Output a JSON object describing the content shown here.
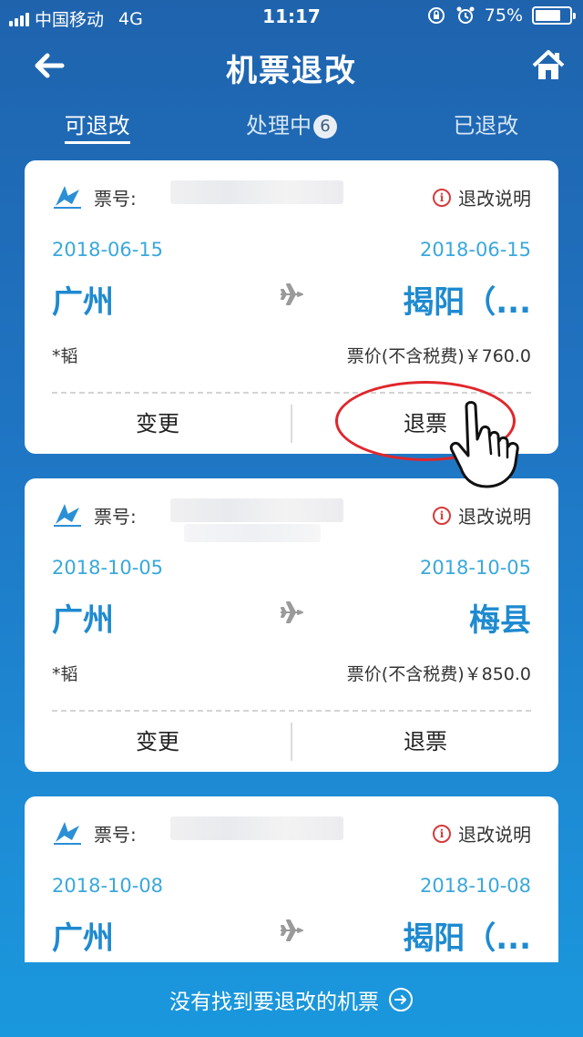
{
  "status_bar": {
    "carrier": "中国移动",
    "network": "4G",
    "time": "11:17",
    "battery": "75%",
    "battery_level": 0.75,
    "icons": [
      "signal-icon",
      "orientation-lock-icon",
      "alarm-icon",
      "battery-icon"
    ]
  },
  "header": {
    "title": "机票退改",
    "back_icon": "arrow-left-icon",
    "home_icon": "home-icon"
  },
  "tabs": [
    {
      "label": "可退改",
      "active": true
    },
    {
      "label": "处理中",
      "badge": "6",
      "active": false
    },
    {
      "label": "已退改",
      "active": false
    }
  ],
  "cards": [
    {
      "ticket_label": "票号:",
      "explain_label": "退改说明",
      "date_from": "2018-06-15",
      "date_to": "2018-06-15",
      "city_from": "广州",
      "city_to": "揭阳（...",
      "passenger": "*韬",
      "price": "票价(不含税费)￥760.0",
      "change_label": "变更",
      "refund_label": "退票"
    },
    {
      "ticket_label": "票号:",
      "explain_label": "退改说明",
      "date_from": "2018-10-05",
      "date_to": "2018-10-05",
      "city_from": "广州",
      "city_to": "梅县",
      "passenger": "*韬",
      "price": "票价(不含税费)￥850.0",
      "change_label": "变更",
      "refund_label": "退票"
    },
    {
      "ticket_label": "票号:",
      "explain_label": "退改说明",
      "date_from": "2018-10-08",
      "date_to": "2018-10-08",
      "city_from": "广州",
      "city_to": "揭阳（..."
    }
  ],
  "footer": {
    "link_label": "没有找到要退改的机票"
  },
  "colors": {
    "accent": "#1e8ad0",
    "date": "#3aa8dc",
    "highlight": "#e0262b",
    "info": "#d63b3b"
  }
}
